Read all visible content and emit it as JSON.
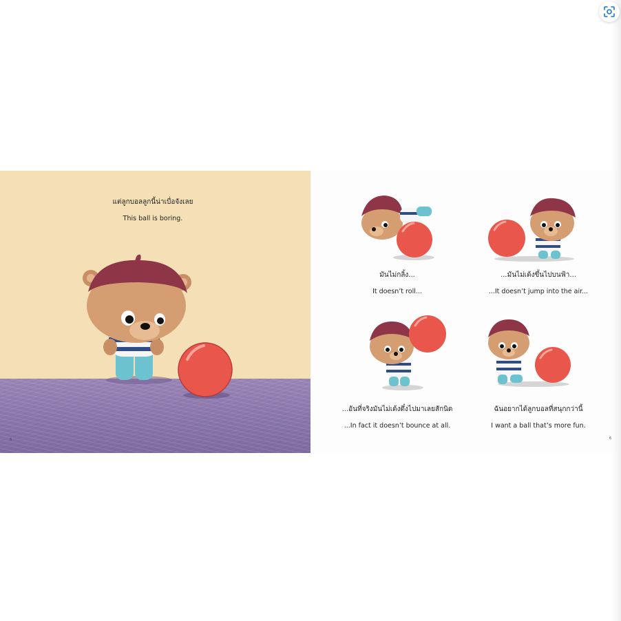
{
  "viewer": {
    "lens_icon": "lens-search-icon"
  },
  "left_page": {
    "thai_text": "แต่ลูกบอลลูกนี้น่าเบื่อจังเลย",
    "english_text": "This ball is boring.",
    "page_number": "6",
    "colors": {
      "wall": "#f4dfb6",
      "carpet": "#8a76aa",
      "ball": "#e9574c",
      "hat": "#8f3548"
    }
  },
  "right_page": {
    "page_number": "6",
    "panels": [
      {
        "thai": "มันไม่กลิ้ง...",
        "english": "It doesn’t roll..."
      },
      {
        "thai": "...มันไม่เด้งขึ้นไปบนฟ้า...",
        "english": "...It doesn’t jump into the air..."
      },
      {
        "thai": "...อันที่จริงมันไม่เด้งดึ๋งไปมาเลยสักนิด",
        "english": "...In fact it doesn’t bounce at all."
      },
      {
        "thai": "ฉันอยากได้ลูกบอลที่สนุกกว่านี้",
        "english": "I want a ball that’s more fun."
      }
    ]
  }
}
